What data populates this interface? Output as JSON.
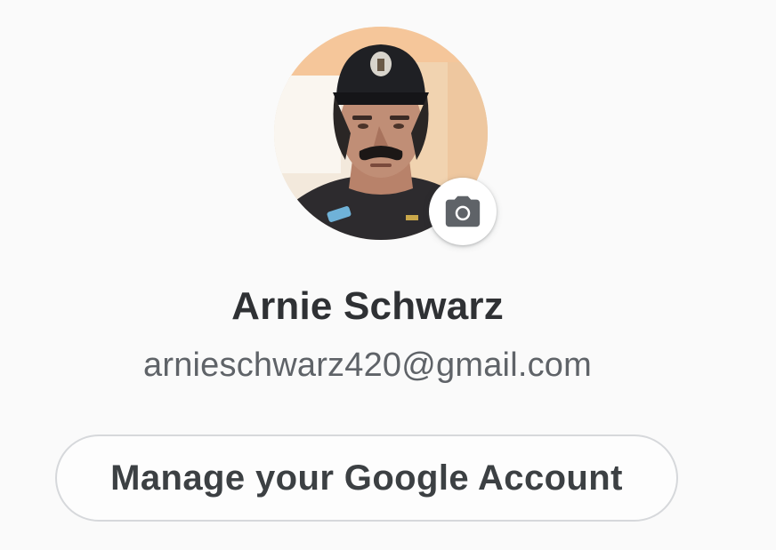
{
  "account": {
    "avatar_icon": "profile-photo",
    "change_photo_icon": "camera-icon",
    "name": "Arnie Schwarz",
    "email": "arnieschwarz420@gmail.com",
    "manage_button_label": "Manage your Google Account"
  },
  "colors": {
    "background": "#fafafa",
    "name_text": "#2f3134",
    "email_text": "#5f6368",
    "button_border": "#d6d8db",
    "button_text": "#3c4043",
    "icon_fill": "#5f6368"
  }
}
